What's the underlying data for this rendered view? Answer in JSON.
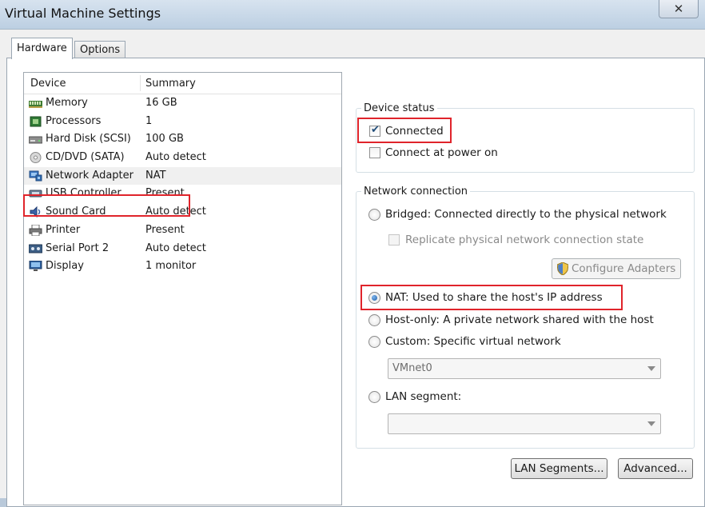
{
  "window": {
    "title": "Virtual Machine Settings",
    "close_glyph": "✕"
  },
  "tabs": [
    {
      "label": "Hardware",
      "active": true
    },
    {
      "label": "Options",
      "active": false
    }
  ],
  "device_list": {
    "columns": {
      "device": "Device",
      "summary": "Summary"
    },
    "rows": [
      {
        "name": "Memory",
        "summary": "16 GB",
        "icon": "memory-icon"
      },
      {
        "name": "Processors",
        "summary": "1",
        "icon": "processor-icon"
      },
      {
        "name": "Hard Disk (SCSI)",
        "summary": "100 GB",
        "icon": "hard-disk-icon"
      },
      {
        "name": "CD/DVD (SATA)",
        "summary": "Auto detect",
        "icon": "cd-dvd-icon"
      },
      {
        "name": "Network Adapter",
        "summary": "NAT",
        "icon": "network-adapter-icon",
        "selected": true
      },
      {
        "name": "USB Controller",
        "summary": "Present",
        "icon": "usb-icon"
      },
      {
        "name": "Sound Card",
        "summary": "Auto detect",
        "icon": "sound-card-icon"
      },
      {
        "name": "Printer",
        "summary": "Present",
        "icon": "printer-icon"
      },
      {
        "name": "Serial Port 2",
        "summary": "Auto detect",
        "icon": "serial-port-icon"
      },
      {
        "name": "Display",
        "summary": "1 monitor",
        "icon": "display-icon"
      }
    ]
  },
  "device_status": {
    "legend": "Device status",
    "connected": {
      "label": "Connected",
      "checked": true
    },
    "connect_at_power_on": {
      "label": "Connect at power on",
      "checked": false
    }
  },
  "network_connection": {
    "legend": "Network connection",
    "bridged": {
      "label": "Bridged: Connected directly to the physical network",
      "checked": false
    },
    "replicate": {
      "label": "Replicate physical network connection state",
      "checked": false,
      "disabled": true
    },
    "configure_adapters": "Configure Adapters",
    "nat": {
      "label": "NAT: Used to share the host's IP address",
      "checked": true
    },
    "host_only": {
      "label": "Host-only: A private network shared with the host",
      "checked": false
    },
    "custom": {
      "label": "Custom: Specific virtual network",
      "checked": false
    },
    "custom_select": "VMnet0",
    "lan_segment": {
      "label": "LAN segment:",
      "checked": false
    },
    "lan_select": ""
  },
  "buttons": {
    "lan_segments": "LAN Segments...",
    "advanced": "Advanced..."
  },
  "colors": {
    "highlight_box": "#e0242b",
    "title_bar": "#c9d8e8"
  }
}
